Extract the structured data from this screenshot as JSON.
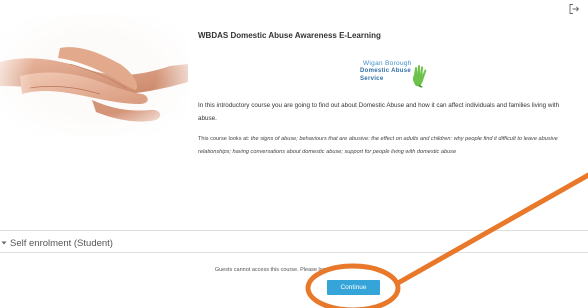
{
  "header": {
    "logout_icon": "logout-icon"
  },
  "course": {
    "title": "WBDAS Domestic Abuse Awareness E-Learning",
    "logo": {
      "line1": "Wigan Borough",
      "line2": "Domestic Abuse",
      "line3": "Service",
      "hand_color": "#6cc24a"
    },
    "intro": "In this introductory course you are going to find out about Domestic Abuse and how it can affect individuals and families living with abuse.",
    "looks_prefix": "This course looks at: ",
    "looks_body": "the signs of abuse; behaviours that are abusive: the effect on adults and children: why people find it difficult to leave abusive relationships; having conversations about domestic abuse; support for people living with domestic abuse"
  },
  "enrolment": {
    "section_title": "Self enrolment (Student)",
    "guest_message": "Guests cannot access this course. Please log in.",
    "continue_label": "Continue",
    "button_color": "#35a5d9"
  },
  "annotation": {
    "color": "#e8782a"
  }
}
